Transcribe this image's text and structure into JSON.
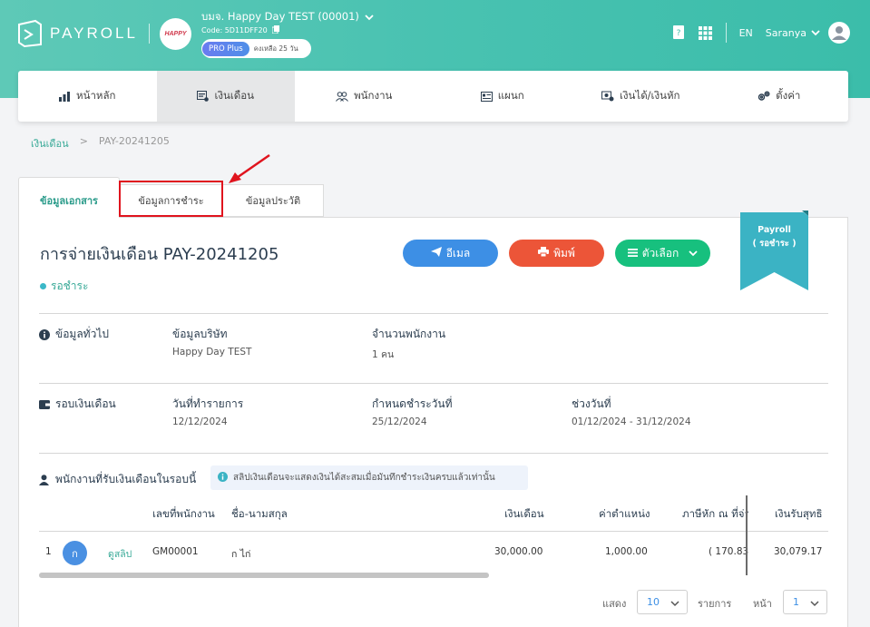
{
  "header": {
    "app_name": "PAYROLL",
    "company_logo_text": "HAPPY",
    "company_name": "บมจ. Happy Day TEST (00001)",
    "company_code": "Code: 5D11DFF20",
    "plan": "PRO Plus",
    "plan_remaining": "คงเหลือ 25 วัน",
    "lang": "EN",
    "user": "Saranya"
  },
  "nav": [
    {
      "label": "หน้าหลัก",
      "icon": "bar-chart-icon"
    },
    {
      "label": "เงินเดือน",
      "icon": "payroll-icon"
    },
    {
      "label": "พนักงาน",
      "icon": "users-icon"
    },
    {
      "label": "แผนก",
      "icon": "department-icon"
    },
    {
      "label": "เงินได้/เงินหัก",
      "icon": "money-icon"
    },
    {
      "label": "ตั้งค่า",
      "icon": "gears-icon"
    }
  ],
  "breadcrumb": {
    "parent": "เงินเดือน",
    "sep": ">",
    "current": "PAY-20241205"
  },
  "tabs": {
    "doc": "ข้อมูลเอกสาร",
    "payment": "ข้อมูลการชำระ",
    "history": "ข้อมูลประวัติ"
  },
  "document": {
    "title": "การจ่ายเงินเดือน PAY-20241205",
    "status": "รอชำระ",
    "ribbon_line1": "Payroll",
    "ribbon_line2": "( รอชำระ )"
  },
  "buttons": {
    "email": "อีเมล",
    "print": "พิมพ์",
    "options": "ตัวเลือก"
  },
  "general": {
    "label": "ข้อมูลทั่วไป",
    "company_label": "ข้อมูลบริษัท",
    "company_value": "Happy Day TEST",
    "employees_label": "จำนวนพนักงาน",
    "employees_value": "1 คน"
  },
  "period": {
    "label": "รอบเงินเดือน",
    "tx_date_label": "วันที่ทำรายการ",
    "tx_date_value": "12/12/2024",
    "due_label": "กำหนดชำระวันที่",
    "due_value": "25/12/2024",
    "range_label": "ช่วงวันที่",
    "range_value": "01/12/2024 - 31/12/2024"
  },
  "employees_section": {
    "label": "พนักงานที่รับเงินเดือนในรอบนี้",
    "note": "สลิปเงินเดือนจะแสดงเงินได้สะสมเมื่อมันทึกชำระเงินครบแล้วเท่านั้น"
  },
  "table": {
    "headers": [
      "เลขที่พนักงาน",
      "ชื่อ-นามสกุล",
      "เงินเดือน",
      "ค่าตำแหน่ง",
      "ภาษีหัก ณ ที่จ่า",
      "เงินรับสุทธิ"
    ],
    "rows": [
      {
        "index": "1",
        "avatar": "ก",
        "slip": "ดูสลิป",
        "emp_no": "GM00001",
        "name": "ก ไก่",
        "salary": "30,000.00",
        "position_pay": "1,000.00",
        "tax": "( 170.83",
        "net": "30,079.17"
      }
    ]
  },
  "pager": {
    "show": "แสดง",
    "per_page": "10",
    "items": "รายการ",
    "page_label": "หน้า",
    "page": "1"
  },
  "colors": {
    "primary": "#3bbdaa",
    "email": "#3d8fe5",
    "print": "#ec5538",
    "options": "#17c07e",
    "ribbon": "#3bb3c4",
    "highlight": "#e0141e"
  }
}
